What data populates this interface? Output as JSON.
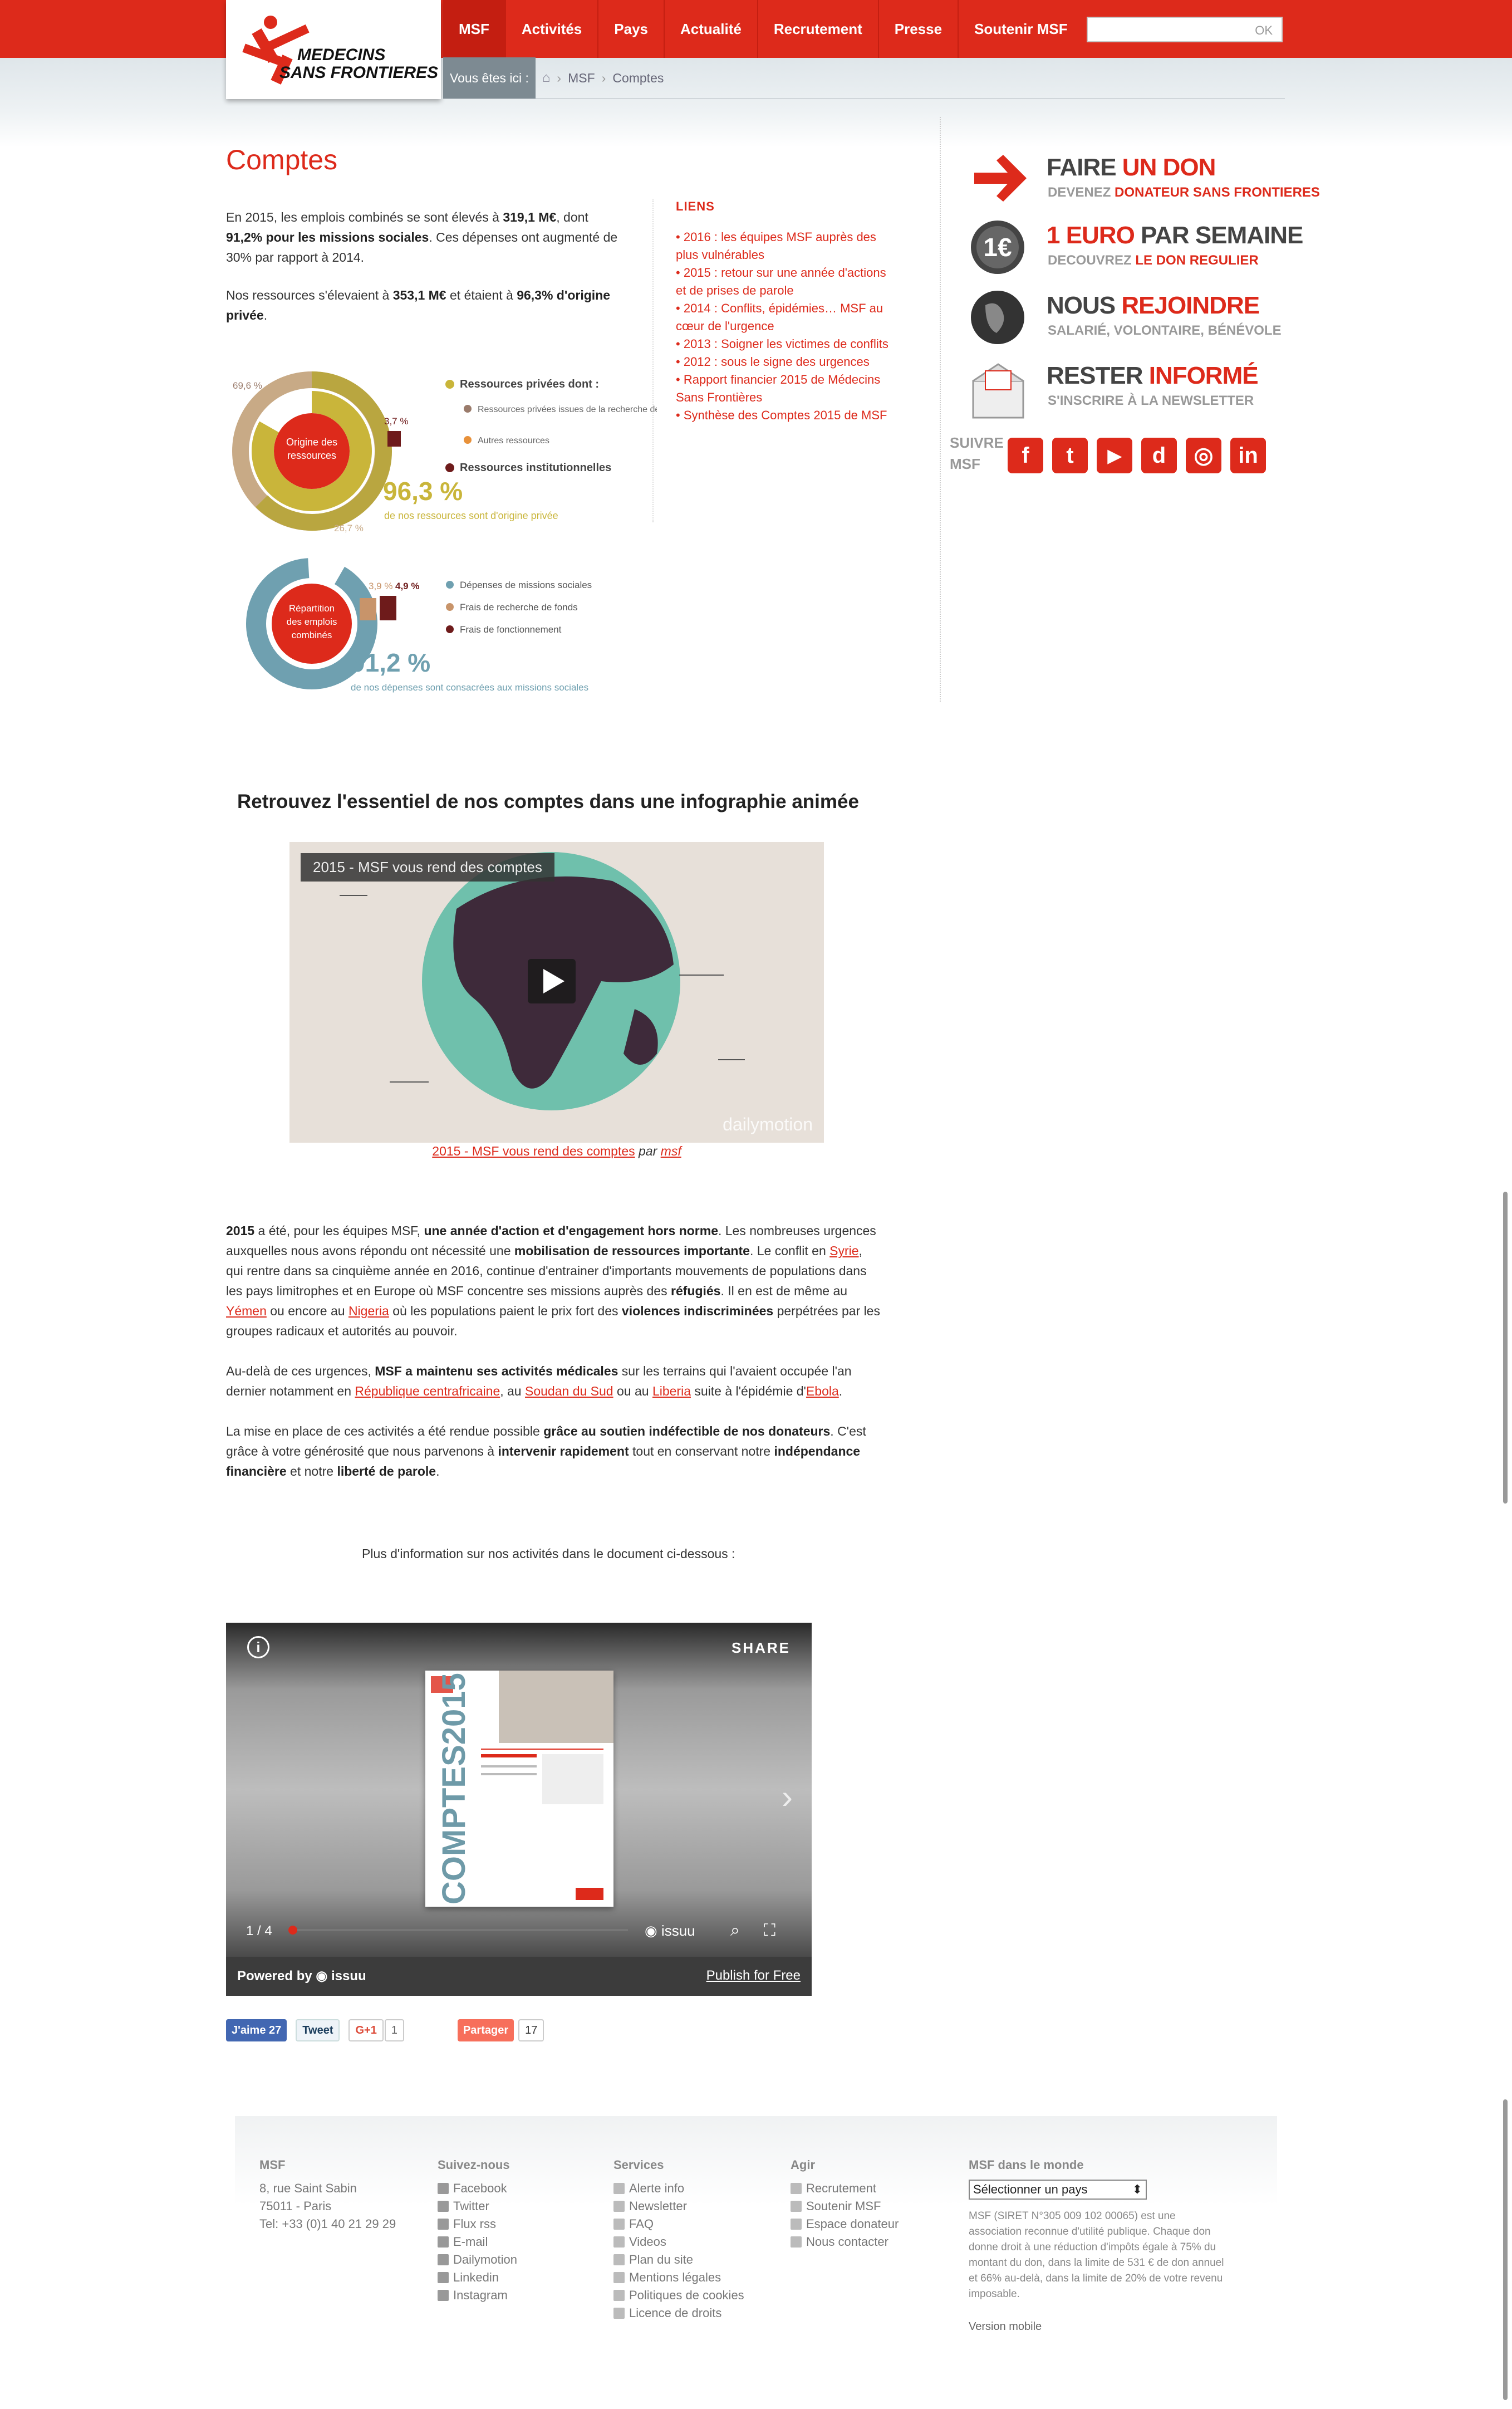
{
  "nav": {
    "items": [
      "MSF",
      "Activités",
      "Pays",
      "Actualité",
      "Recrutement",
      "Presse",
      "Soutenir MSF"
    ],
    "search_button": "OK",
    "search_placeholder": ""
  },
  "logo": {
    "line1": "MEDECINS",
    "line2": "SANS FRONTIERES"
  },
  "breadcrumb": {
    "label": "Vous êtes ici :",
    "items": [
      "MSF",
      "Comptes"
    ]
  },
  "page_title": "Comptes",
  "intro": {
    "p1_a": "En 2015, les emplois combinés se sont élevés à ",
    "p1_b": "319,1 M€",
    "p1_c": ", dont ",
    "p1_d": "91,2% pour les missions sociales",
    "p1_e": ". Ces dépenses ont augmenté de 30% par rapport à 2014.",
    "p2_a": "Nos ressources s'élevaient à ",
    "p2_b": "353,1 M€",
    "p2_c": " et étaient à ",
    "p2_d": "96,3% d'origine privée",
    "p2_e": "."
  },
  "links": {
    "title": "LIENS",
    "items": [
      "2016 : les équipes MSF auprès des plus vulnérables",
      "2015 : retour sur une année d'actions et de prises de parole",
      "2014 : Conflits, épidémies… MSF au cœur de l'urgence",
      "2013 : Soigner les victimes de conflits",
      "2012 : sous le signe des urgences",
      "Rapport financier 2015 de Médecins Sans Frontières",
      "Synthèse des Comptes 2015 de MSF"
    ]
  },
  "promos": [
    {
      "t1a": "FAIRE ",
      "t1b": "UN DON",
      "t2a": "DEVENEZ ",
      "t2b": "DONATEUR SANS FRONTIERES"
    },
    {
      "t1a": "1 EURO ",
      "t1b": "PAR SEMAINE",
      "t2a": "DECOUVREZ ",
      "t2b": "LE DON REGULIER"
    },
    {
      "t1a": "NOUS ",
      "t1b": "REJOINDRE",
      "t2a": "SALARIÉ, VOLONTAIRE, BÉNÉVOLE",
      "t2b": ""
    },
    {
      "t1a": "RESTER ",
      "t1b": "INFORMÉ",
      "t2a": "S'INSCRIRE À LA NEWSLETTER",
      "t2b": ""
    }
  ],
  "follow": {
    "line1": "SUIVRE",
    "line2": "MSF",
    "icons": [
      "f",
      "t",
      "▶",
      "d",
      "◎",
      "in"
    ]
  },
  "infographic": {
    "ring1": {
      "center": "Origine des ressources",
      "pct_outer": "69,6 %",
      "pct_inst": "3,7 %",
      "pct_other": "26,7 %",
      "legend_title": "Ressources privées dont :",
      "legend_sub1": "Ressources privées issues de la recherche de fonds",
      "legend_sub2": "Autres ressources",
      "legend_inst": "Ressources institutionnelles",
      "big": "96,3 %",
      "caption": "de nos ressources sont d'origine privée"
    },
    "ring2": {
      "center": "Répartition des emplois combinés",
      "pct_a": "3,9 %",
      "pct_b": "4,9 %",
      "legend1": "Dépenses de missions sociales",
      "legend2": "Frais de recherche de fonds",
      "legend3": "Frais de fonctionnement",
      "big": "91,2 %",
      "caption": "de nos dépenses sont consacrées aux missions sociales"
    },
    "colors": {
      "olive": "#c9b53a",
      "red": "#dd2a1b",
      "orange": "#e8913a",
      "brown": "#9a7b6b",
      "blue": "#6fa0b0",
      "maroon": "#6e1b1b"
    }
  },
  "info_title": "Retrouvez l'essentiel de nos comptes dans une infographie animée",
  "video": {
    "title": "2015 - MSF vous rend des comptes",
    "brand": "dailymotion",
    "caption_link": "2015 - MSF vous rend des comptes",
    "caption_par": "par",
    "caption_user": "msf"
  },
  "body": {
    "p1": [
      [
        "b",
        "2015"
      ],
      [
        "t",
        " a été, pour les équipes MSF, "
      ],
      [
        "b",
        "une année d'action et d'engagement hors norme"
      ],
      [
        "t",
        ". Les nombreuses urgences auxquelles nous avons répondu ont nécessité une "
      ],
      [
        "b",
        "mobilisation de ressources importante"
      ],
      [
        "t",
        ". Le conflit en "
      ],
      [
        "l",
        "Syrie"
      ],
      [
        "t",
        ", qui rentre dans sa cinquième année en 2016, continue d'entrainer d'importants mouvements de populations dans les pays limitrophes et en Europe où MSF concentre ses missions auprès des "
      ],
      [
        "b",
        "réfugiés"
      ],
      [
        "t",
        ". Il en est de même au "
      ],
      [
        "l",
        "Yémen"
      ],
      [
        "t",
        " ou encore au "
      ],
      [
        "l",
        "Nigeria"
      ],
      [
        "t",
        " où les populations paient le prix fort des "
      ],
      [
        "b",
        "violences indiscriminées"
      ],
      [
        "t",
        " perpétrées par les groupes radicaux et autorités au pouvoir."
      ]
    ],
    "p2": [
      [
        "t",
        "Au-delà de ces urgences, "
      ],
      [
        "b",
        "MSF a maintenu ses activités médicales"
      ],
      [
        "t",
        " sur les terrains qui l'avaient occupée l'an dernier notamment en "
      ],
      [
        "l",
        "République centrafricaine"
      ],
      [
        "t",
        ", au "
      ],
      [
        "l",
        "Soudan du Sud"
      ],
      [
        "t",
        " ou au "
      ],
      [
        "l",
        "Liberia"
      ],
      [
        "t",
        " suite à l'épidémie d'"
      ],
      [
        "l",
        "Ebola"
      ],
      [
        "t",
        "."
      ]
    ],
    "p3": [
      [
        "t",
        "La mise en place de ces activités a été rendue possible "
      ],
      [
        "b",
        "grâce au soutien indéfectible de nos donateurs"
      ],
      [
        "t",
        ". C'est grâce à votre générosité que nous parvenons à "
      ],
      [
        "b",
        "intervenir rapidement"
      ],
      [
        "t",
        " tout en conservant notre "
      ],
      [
        "b",
        "indépendance financière"
      ],
      [
        "t",
        " et notre "
      ],
      [
        "b",
        "liberté de parole"
      ],
      [
        "t",
        "."
      ]
    ],
    "more": "Plus d'information sur nos activités dans le document ci-dessous :"
  },
  "issuu": {
    "share": "SHARE",
    "page": "1 / 4",
    "brand": "issuu",
    "powered": "Powered by",
    "publish": "Publish for Free",
    "cover_title": "COMPTES2015"
  },
  "share": {
    "like": "J'aime 27",
    "tweet": "Tweet",
    "gplus": "G+1",
    "gplus_count": "1",
    "partager": "Partager",
    "partager_count": "17"
  },
  "footer": {
    "msf": {
      "title": "MSF",
      "lines": [
        "8, rue Saint Sabin",
        "75011 - Paris",
        "Tel: +33 (0)1 40 21 29 29"
      ]
    },
    "suivez": {
      "title": "Suivez-nous",
      "items": [
        "Facebook",
        "Twitter",
        "Flux rss",
        "E-mail",
        "Dailymotion",
        "Linkedin",
        "Instagram"
      ]
    },
    "services": {
      "title": "Services",
      "items": [
        "Alerte info",
        "Newsletter",
        "FAQ",
        "Videos",
        "Plan du site",
        "Mentions légales",
        "Politiques de cookies",
        "Licence de droits"
      ]
    },
    "agir": {
      "title": "Agir",
      "items": [
        "Recrutement",
        "Soutenir MSF",
        "Espace donateur",
        "Nous contacter"
      ]
    },
    "monde": {
      "title": "MSF dans le monde",
      "select": "Sélectionner un pays",
      "legal": "MSF (SIRET N°305 009 102 00065) est une association reconnue d'utilité publique. Chaque don donne droit à une réduction d'impôts égale à 75% du montant du don, dans la limite de 531 € de don annuel et 66% au-delà, dans la limite de 20% de votre revenu imposable.",
      "mobile": "Version mobile"
    }
  }
}
